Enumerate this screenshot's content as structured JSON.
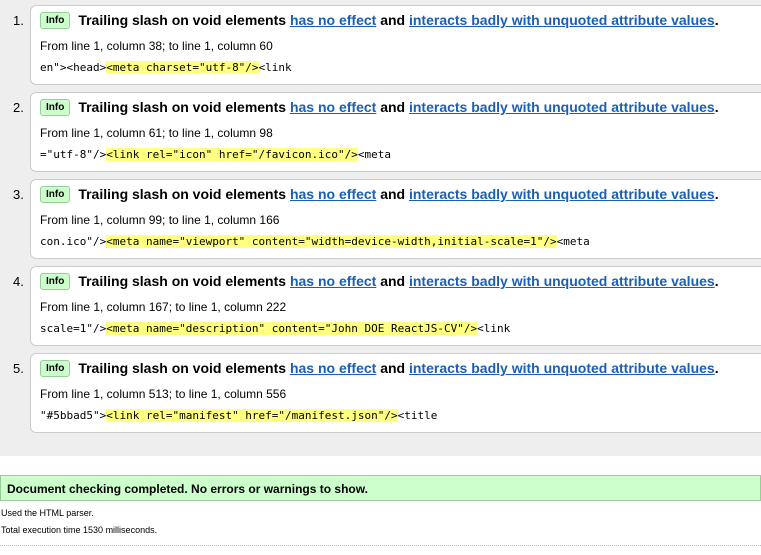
{
  "messages": [
    {
      "num": "1.",
      "badge": "Info",
      "title": "Trailing slash on void elements",
      "link1": "has no effect",
      "and": "and",
      "link2": "interacts badly with unquoted attribute values",
      "period": ".",
      "location": "From line 1, column 38; to line 1, column 60",
      "code_before": "en\"><head>",
      "code_highlight": "<meta charset=\"utf-8\"/>",
      "code_after": "<link"
    },
    {
      "num": "2.",
      "badge": "Info",
      "title": "Trailing slash on void elements",
      "link1": "has no effect",
      "and": "and",
      "link2": "interacts badly with unquoted attribute values",
      "period": ".",
      "location": "From line 1, column 61; to line 1, column 98",
      "code_before": "=\"utf-8\"/>",
      "code_highlight": "<link rel=\"icon\" href=\"/favicon.ico\"/>",
      "code_after": "<meta"
    },
    {
      "num": "3.",
      "badge": "Info",
      "title": "Trailing slash on void elements",
      "link1": "has no effect",
      "and": "and",
      "link2": "interacts badly with unquoted attribute values",
      "period": ".",
      "location": "From line 1, column 99; to line 1, column 166",
      "code_before": "con.ico\"/>",
      "code_highlight": "<meta name=\"viewport\" content=\"width=device-width,initial-scale=1\"/>",
      "code_after": "<meta"
    },
    {
      "num": "4.",
      "badge": "Info",
      "title": "Trailing slash on void elements",
      "link1": "has no effect",
      "and": "and",
      "link2": "interacts badly with unquoted attribute values",
      "period": ".",
      "location": "From line 1, column 167; to line 1, column 222",
      "code_before": "scale=1\"/>",
      "code_highlight": "<meta name=\"description\" content=\"John DOE ReactJS-CV\"/>",
      "code_after": "<link"
    },
    {
      "num": "5.",
      "badge": "Info",
      "title": "Trailing slash on void elements",
      "link1": "has no effect",
      "and": "and",
      "link2": "interacts badly with unquoted attribute values",
      "period": ".",
      "location": "From line 1, column 513; to line 1, column 556",
      "code_before": "\"#5bbad5\">",
      "code_highlight": "<link rel=\"manifest\" href=\"/manifest.json\"/>",
      "code_after": "<title"
    }
  ],
  "summary": "Document checking completed. No errors or warnings to show.",
  "footer": {
    "parser": "Used the HTML parser.",
    "time": "Total execution time 1530 milliseconds."
  },
  "colors": {
    "link": "#1a5fb4",
    "highlight": "#ffff80",
    "success_bg": "#ccffcc",
    "panel_bg": "#eeeeee"
  }
}
